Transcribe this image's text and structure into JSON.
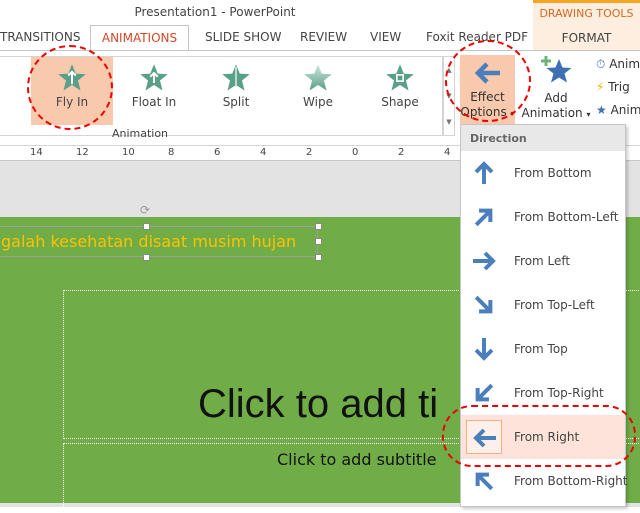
{
  "window": {
    "title": "Presentation1 - PowerPoint"
  },
  "context_tab": {
    "group": "DRAWING TOOLS",
    "tab": "FORMAT"
  },
  "tabs": [
    "TRANSITIONS",
    "ANIMATIONS",
    "SLIDE SHOW",
    "REVIEW",
    "VIEW",
    "Foxit Reader PDF"
  ],
  "active_tab": "ANIMATIONS",
  "gallery": {
    "items": [
      "Fly In",
      "Float In",
      "Split",
      "Wipe",
      "Shape"
    ],
    "selected": "Fly In",
    "group_label": "Animation"
  },
  "effect_options": {
    "line1": "Effect",
    "line2": "Options",
    "caret": "▾"
  },
  "add_animation": {
    "line1": "Add",
    "line2": "Animation",
    "caret": "▾"
  },
  "side_buttons": [
    "Anim",
    "Trig",
    "Anim"
  ],
  "ruler": [
    "14",
    "12",
    "10",
    "8",
    "6",
    "4",
    "2",
    "0",
    "2",
    "4"
  ],
  "slide": {
    "textbox": "galah kesehatan disaat musim hujan",
    "title_placeholder": "Click to add ti",
    "subtitle_placeholder": "Click to add subtitle",
    "background": "#70ad47",
    "text_color": "#ffc000"
  },
  "direction_menu": {
    "header": "Direction",
    "selected": "From Right",
    "items": [
      {
        "label": "From Bottom",
        "icon": "arrow-up-icon"
      },
      {
        "label": "From Bottom-Left",
        "icon": "arrow-up-right-icon"
      },
      {
        "label": "From Left",
        "icon": "arrow-right-icon"
      },
      {
        "label": "From Top-Left",
        "icon": "arrow-down-right-icon"
      },
      {
        "label": "From Top",
        "icon": "arrow-down-icon"
      },
      {
        "label": "From Top-Right",
        "icon": "arrow-down-left-icon"
      },
      {
        "label": "From Right",
        "icon": "arrow-left-icon"
      },
      {
        "label": "From Bottom-Right",
        "icon": "arrow-up-left-icon"
      }
    ]
  },
  "colors": {
    "accent": "#d24726",
    "highlight": "#f8c9ad",
    "arrow": "#4a7fbb",
    "annotation": "#e00000"
  }
}
